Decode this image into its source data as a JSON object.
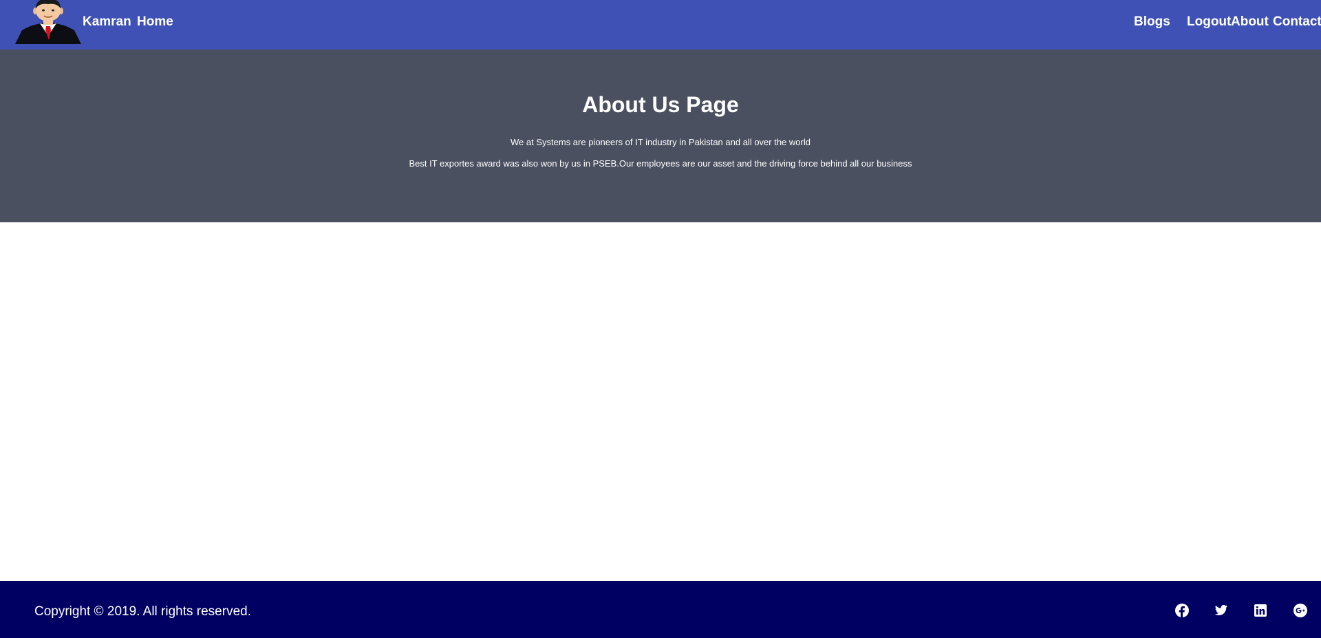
{
  "header": {
    "brand": "Kamran",
    "nav_left": [
      "Home"
    ],
    "nav_right": [
      "Blogs",
      "Logout",
      "About",
      "Contact"
    ],
    "bg_color": "#3f51b5"
  },
  "hero": {
    "title": "About Us Page",
    "lines": [
      "We at Systems are pioneers of IT industry in Pakistan and all over the world",
      "Best IT exportes award was also won by us in PSEB.Our employees are our asset and the driving force behind all our business"
    ],
    "bg_color": "#4a505f"
  },
  "footer": {
    "copyright": "Copyright © 2019. All rights reserved.",
    "social": [
      "facebook-icon",
      "twitter-icon",
      "linkedin-icon",
      "google-plus-icon"
    ],
    "bg_color": "#000062"
  }
}
